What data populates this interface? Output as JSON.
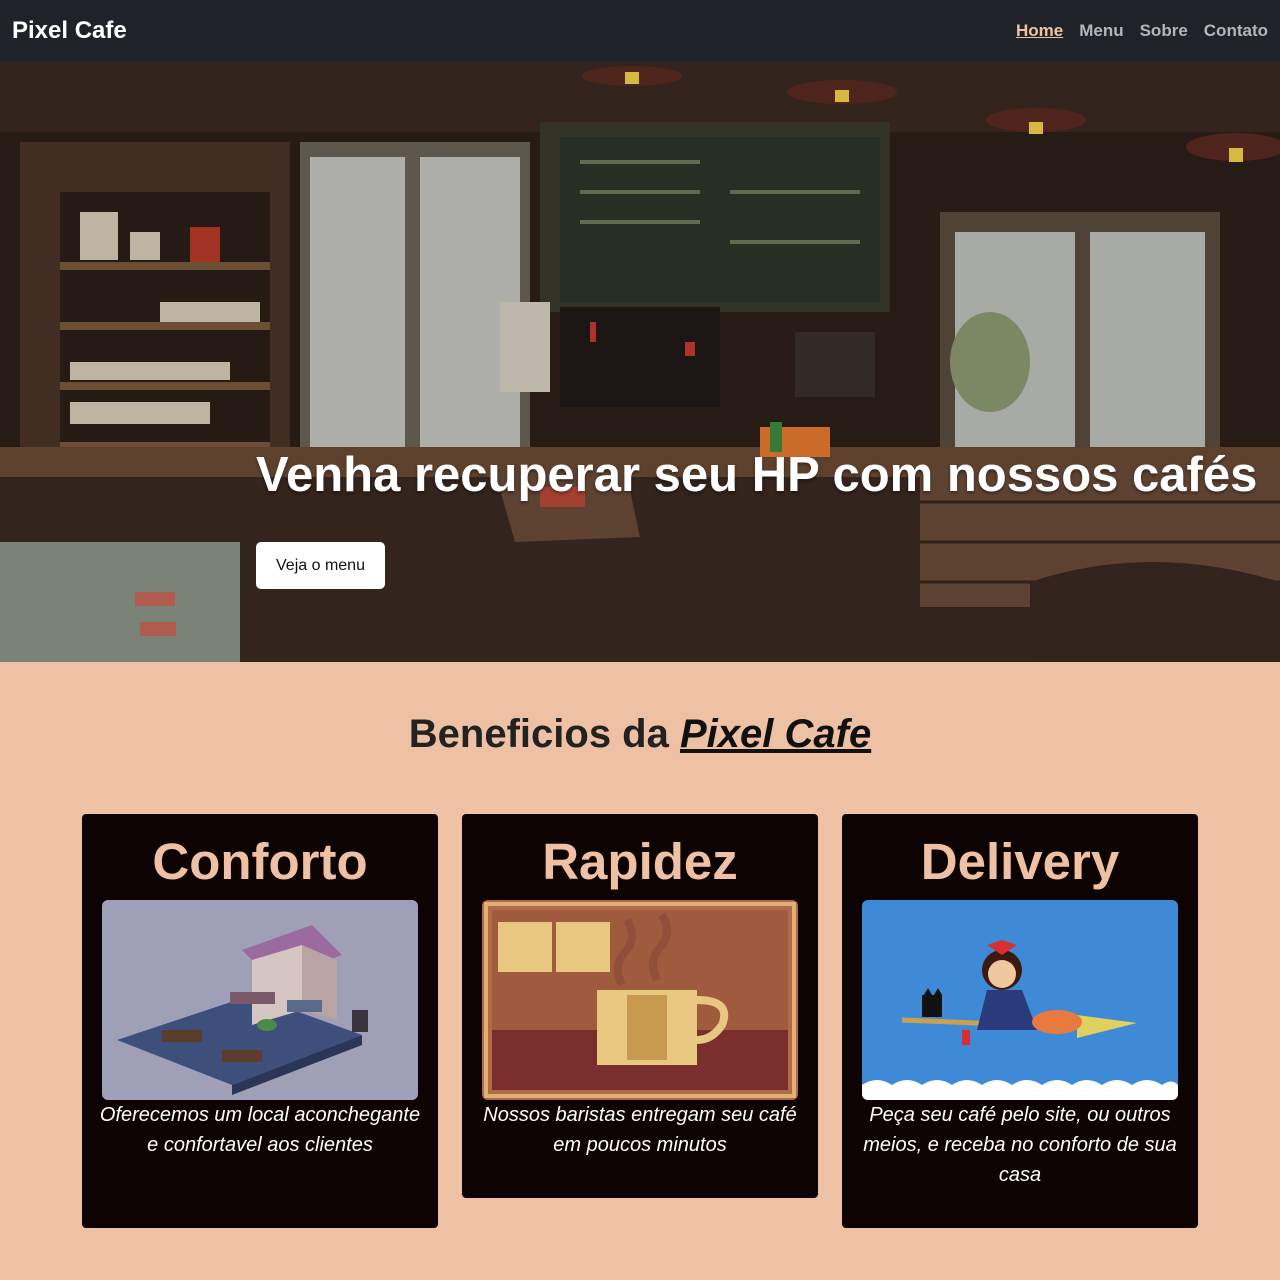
{
  "nav": {
    "brand": "Pixel Cafe",
    "links": [
      "Home",
      "Menu",
      "Sobre",
      "Contato"
    ],
    "active": "Home"
  },
  "hero": {
    "title": "Venha recuperar seu HP com nossos cafés",
    "button": "Veja o menu"
  },
  "benefits": {
    "title_prefix": "Beneficios da",
    "title_brand": "Pixel Cafe",
    "cards": [
      {
        "title": "Conforto",
        "text": "Oferecemos um local aconchegante e confortavel aos clientes"
      },
      {
        "title": "Rapidez",
        "text": "Nossos baristas entregam seu café em poucos minutos"
      },
      {
        "title": "Delivery",
        "text": "Peça seu café pelo site, ou outros meios, e receba no conforto de sua casa"
      }
    ]
  },
  "colors": {
    "navbar": "#1f2329",
    "accent": "#efc1a4",
    "card_bg": "#0e0303",
    "page_bg": "#efc1a4"
  }
}
